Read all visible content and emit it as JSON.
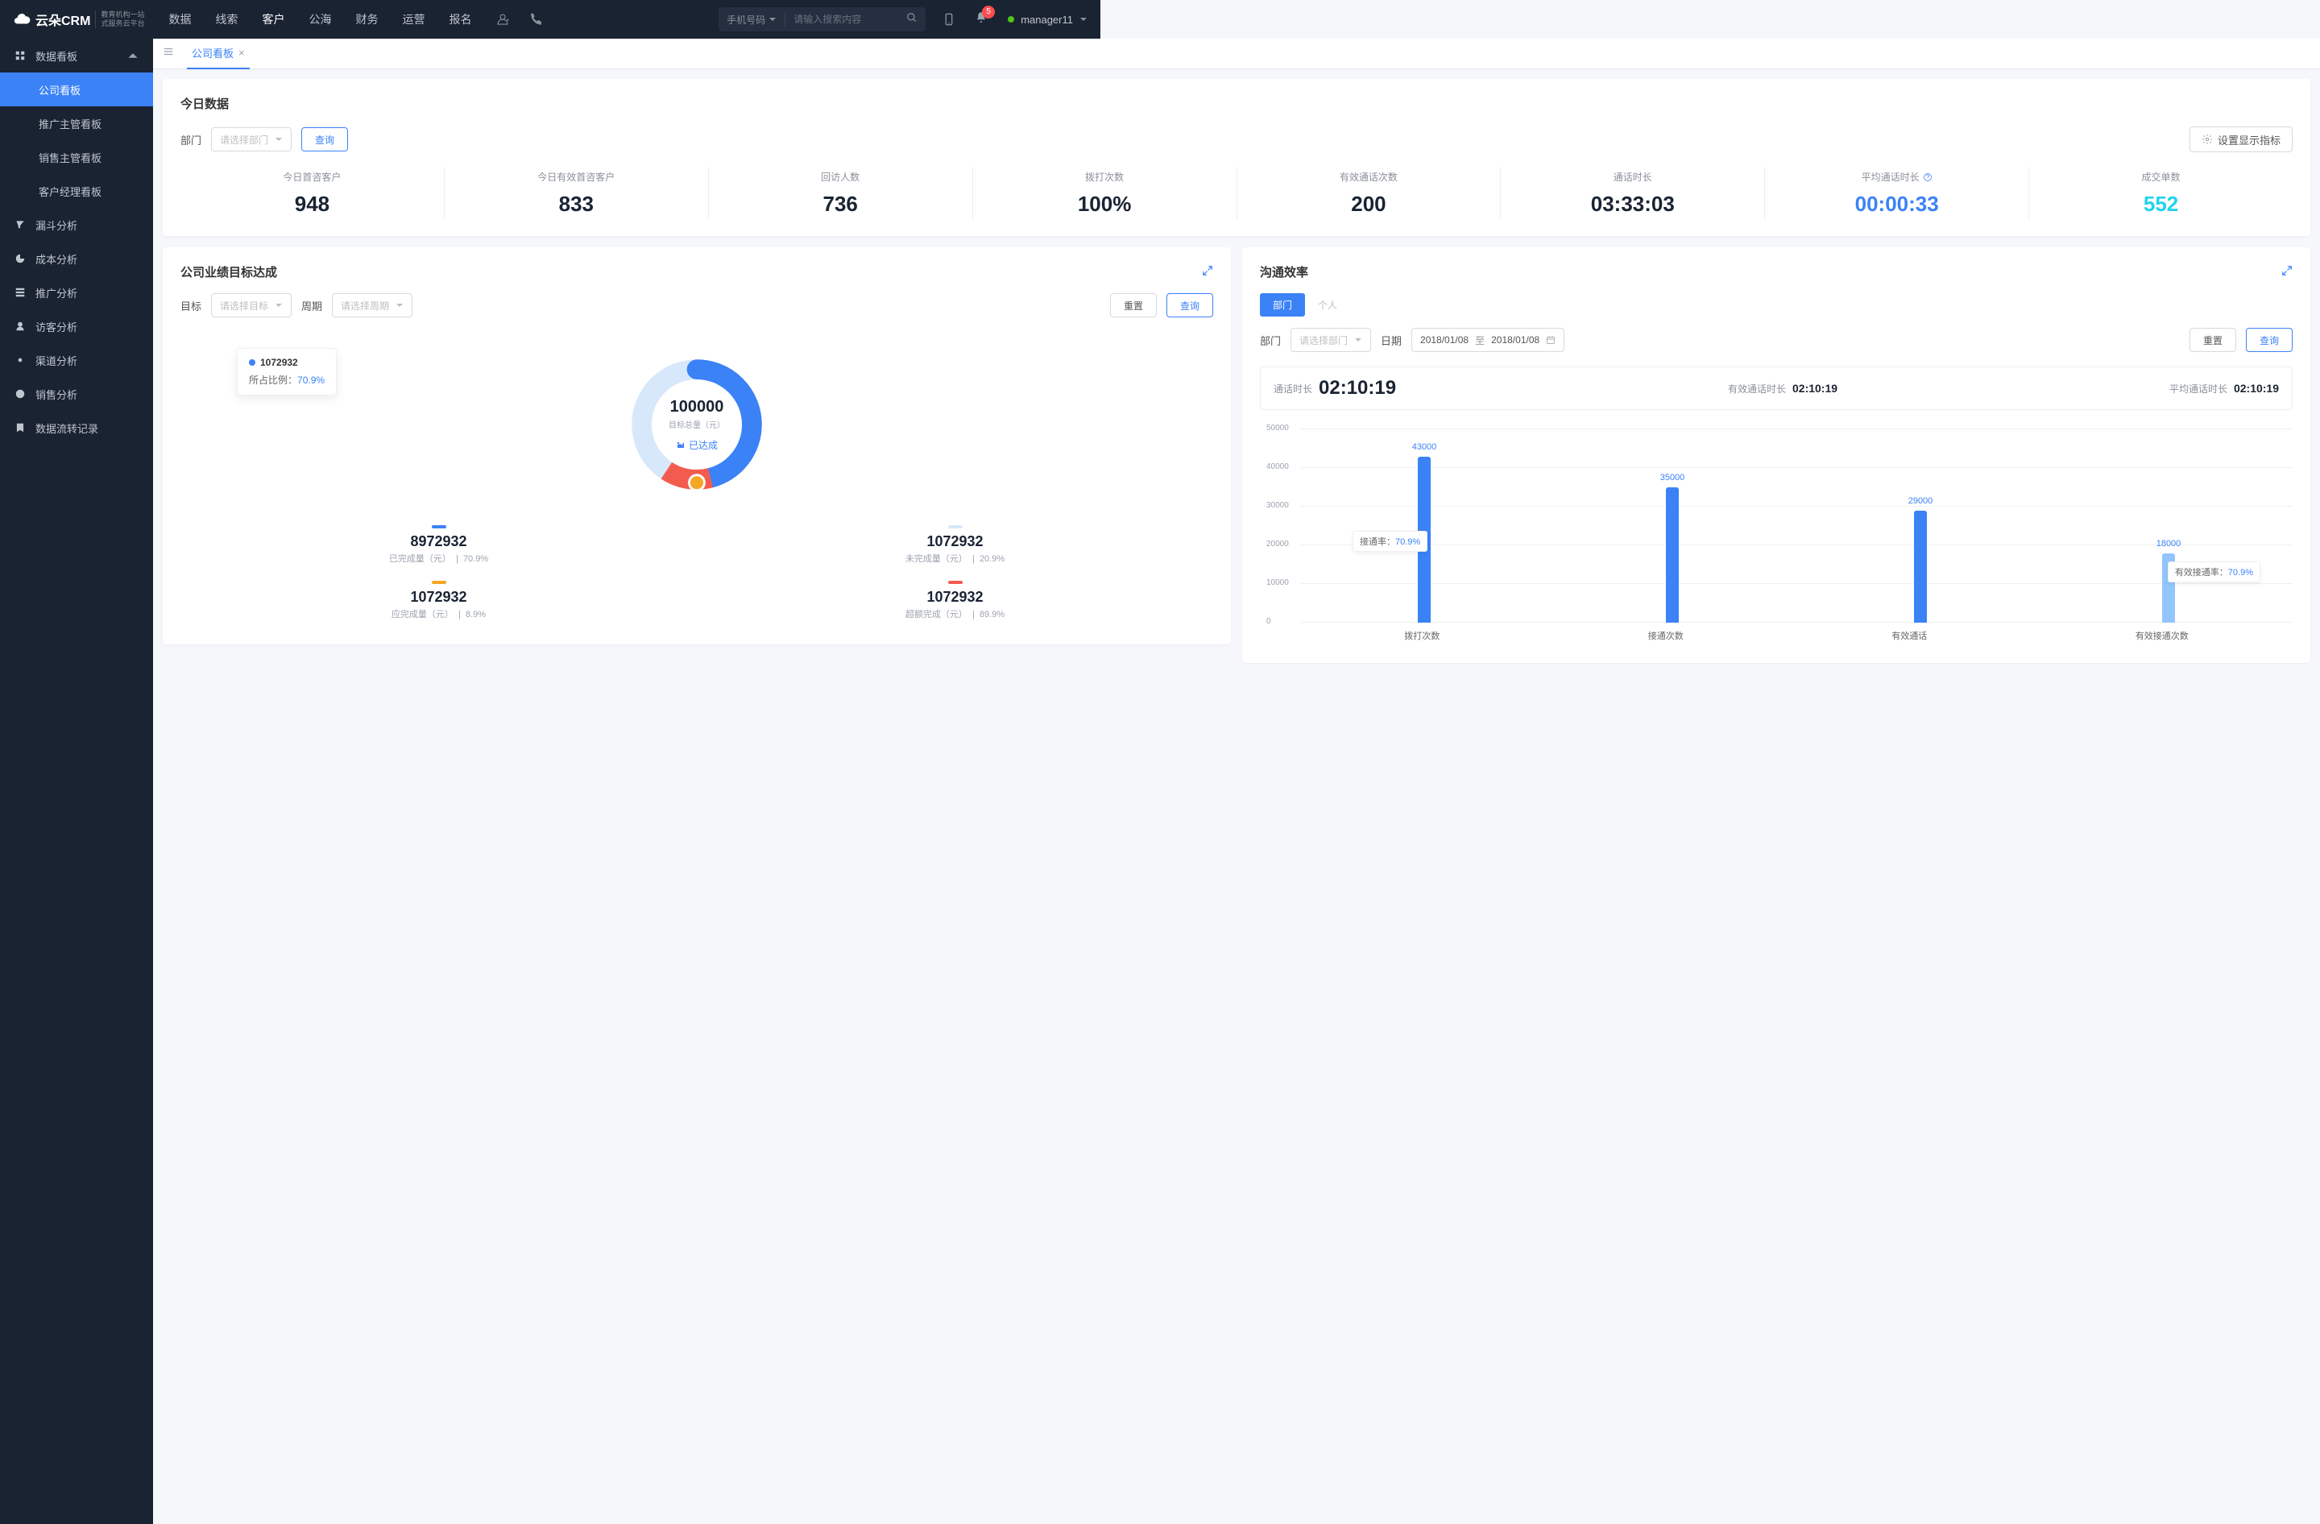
{
  "header": {
    "logo_main": "云朵CRM",
    "logo_sub1": "教育机构一站",
    "logo_sub2": "式服务云平台",
    "nav": [
      "数据",
      "线索",
      "客户",
      "公海",
      "财务",
      "运营",
      "报名"
    ],
    "nav_active": 2,
    "search_type": "手机号码",
    "search_placeholder": "请输入搜索内容",
    "badge_count": "5",
    "user": "manager11"
  },
  "sidebar": {
    "group_label": "数据看板",
    "children": [
      "公司看板",
      "推广主管看板",
      "销售主管看板",
      "客户经理看板"
    ],
    "items": [
      "漏斗分析",
      "成本分析",
      "推广分析",
      "访客分析",
      "渠道分析",
      "销售分析",
      "数据流转记录"
    ]
  },
  "tab": {
    "label": "公司看板"
  },
  "today": {
    "title": "今日数据",
    "dept_label": "部门",
    "dept_placeholder": "请选择部门",
    "query_btn": "查询",
    "settings_btn": "设置显示指标",
    "metrics": [
      {
        "label": "今日首咨客户",
        "value": "948",
        "cls": ""
      },
      {
        "label": "今日有效首咨客户",
        "value": "833",
        "cls": ""
      },
      {
        "label": "回访人数",
        "value": "736",
        "cls": ""
      },
      {
        "label": "拨打次数",
        "value": "100%",
        "cls": ""
      },
      {
        "label": "有效通话次数",
        "value": "200",
        "cls": ""
      },
      {
        "label": "通话时长",
        "value": "03:33:03",
        "cls": ""
      },
      {
        "label": "平均通话时长",
        "value": "00:00:33",
        "cls": "blue",
        "help": true
      },
      {
        "label": "成交单数",
        "value": "552",
        "cls": "cyan"
      }
    ]
  },
  "target_panel": {
    "title": "公司业绩目标达成",
    "target_label": "目标",
    "target_placeholder": "请选择目标",
    "period_label": "周期",
    "period_placeholder": "请选择周期",
    "reset_btn": "重置",
    "query_btn": "查询",
    "donut_center_value": "100000",
    "donut_center_label": "目标总量（元）",
    "donut_status": "已达成",
    "tooltip_value": "1072932",
    "tooltip_ratio_label": "所占比例：",
    "tooltip_ratio_value": "70.9%",
    "stats": [
      {
        "color": "#3b82f6",
        "value": "8972932",
        "label": "已完成量（元）",
        "pct": "70.9%"
      },
      {
        "color": "#d8e8fb",
        "value": "1072932",
        "label": "未完成量（元）",
        "pct": "20.9%"
      },
      {
        "color": "#f5a623",
        "value": "1072932",
        "label": "应完成量（元）",
        "pct": "8.9%"
      },
      {
        "color": "#f45b4f",
        "value": "1072932",
        "label": "超额完成（元）",
        "pct": "89.9%"
      }
    ]
  },
  "comm_panel": {
    "title": "沟通效率",
    "seg_tabs": [
      "部门",
      "个人"
    ],
    "dept_label": "部门",
    "dept_placeholder": "请选择部门",
    "date_label": "日期",
    "date_from": "2018/01/08",
    "date_sep": "至",
    "date_to": "2018/01/08",
    "reset_btn": "重置",
    "query_btn": "查询",
    "durations": [
      {
        "label": "通话时长",
        "value": "02:10:19",
        "big": true
      },
      {
        "label": "有效通话时长",
        "value": "02:10:19"
      },
      {
        "label": "平均通话时长",
        "value": "02:10:19"
      }
    ],
    "ann1_label": "接通率：",
    "ann1_value": "70.9%",
    "ann2_label": "有效接通率：",
    "ann2_value": "70.9%"
  },
  "chart_data": [
    {
      "type": "pie",
      "title": "公司业绩目标达成",
      "values": [
        70.9,
        20.9,
        8.2
      ],
      "series_names": [
        "已完成",
        "未完成",
        "超额"
      ],
      "colors": [
        "#3b82f6",
        "#d8e8fb",
        "#f45b4f"
      ],
      "center_text": "100000 目标总量（元）"
    },
    {
      "type": "bar",
      "title": "沟通效率",
      "categories": [
        "拨打次数",
        "接通次数",
        "有效通话",
        "有效接通次数"
      ],
      "values": [
        43000,
        35000,
        29000,
        18000
      ],
      "ylim": [
        0,
        50000
      ],
      "yticks": [
        0,
        10000,
        20000,
        30000,
        40000,
        50000
      ],
      "annotations": [
        {
          "text": "接通率：70.9%",
          "between": [
            0,
            1
          ]
        },
        {
          "text": "有效接通率：70.9%",
          "between": [
            2,
            3
          ]
        }
      ]
    }
  ]
}
